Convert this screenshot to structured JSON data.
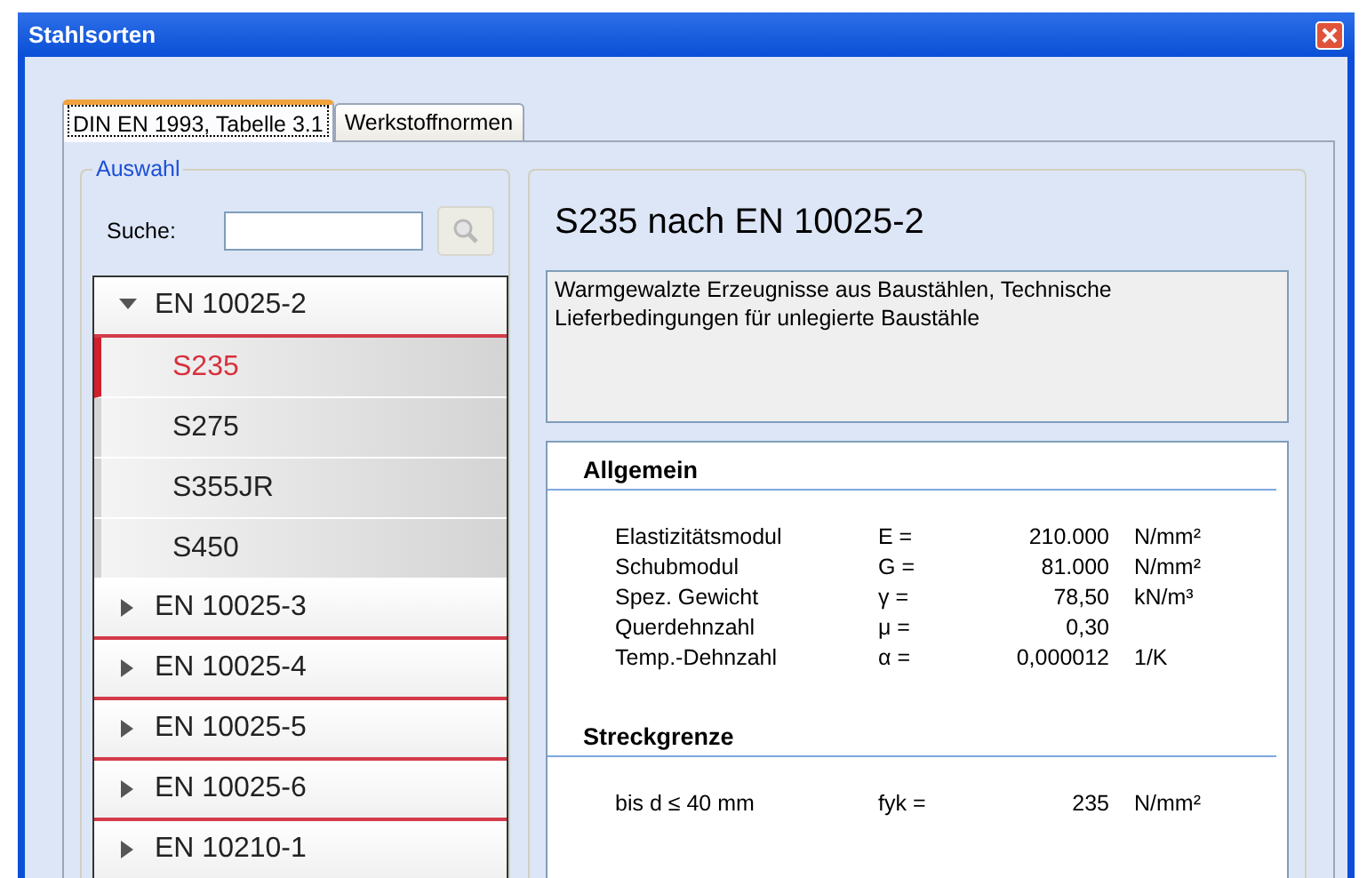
{
  "window": {
    "title": "Stahlsorten"
  },
  "tabs": [
    {
      "label": "DIN EN 1993, Tabelle 3.1",
      "selected": true
    },
    {
      "label": "Werkstoffnormen",
      "selected": false
    }
  ],
  "selection": {
    "title": "Auswahl",
    "search": {
      "label": "Suche:"
    },
    "tree": [
      {
        "label": "EN 10025-2",
        "expanded": true,
        "children": [
          {
            "label": "S235",
            "selected": true
          },
          {
            "label": "S275",
            "selected": false
          },
          {
            "label": "S355JR",
            "selected": false
          },
          {
            "label": "S450",
            "selected": false
          }
        ]
      },
      {
        "label": "EN 10025-3",
        "expanded": false
      },
      {
        "label": "EN 10025-4",
        "expanded": false
      },
      {
        "label": "EN 10025-5",
        "expanded": false
      },
      {
        "label": "EN 10025-6",
        "expanded": false
      },
      {
        "label": "EN 10210-1",
        "expanded": false
      }
    ]
  },
  "detail": {
    "title": "S235 nach EN 10025-2",
    "description": "Warmgewalzte Erzeugnisse aus Baustählen, Technische Lieferbedingungen für unlegierte Baustähle",
    "sections": [
      {
        "title": "Allgemein",
        "rows": [
          {
            "name": "Elastizitätsmodul",
            "symbol": "E =",
            "value": "210.000",
            "unit": "N/mm²"
          },
          {
            "name": "Schubmodul",
            "symbol": "G =",
            "value": "81.000",
            "unit": "N/mm²"
          },
          {
            "name": "Spez. Gewicht",
            "symbol": "γ =",
            "value": "78,50",
            "unit": "kN/m³"
          },
          {
            "name": "Querdehnzahl",
            "symbol": "μ =",
            "value": "0,30"
          },
          {
            "name": "Temp.-Dehnzahl",
            "symbol": "α =",
            "value": "0,000012",
            "unit": "1/K"
          }
        ]
      },
      {
        "title": "Streckgrenze",
        "rows": [
          {
            "name": "bis d ≤ 40 mm",
            "symbol": "fyk =",
            "value": "235",
            "unit": "N/mm²"
          }
        ]
      }
    ]
  }
}
